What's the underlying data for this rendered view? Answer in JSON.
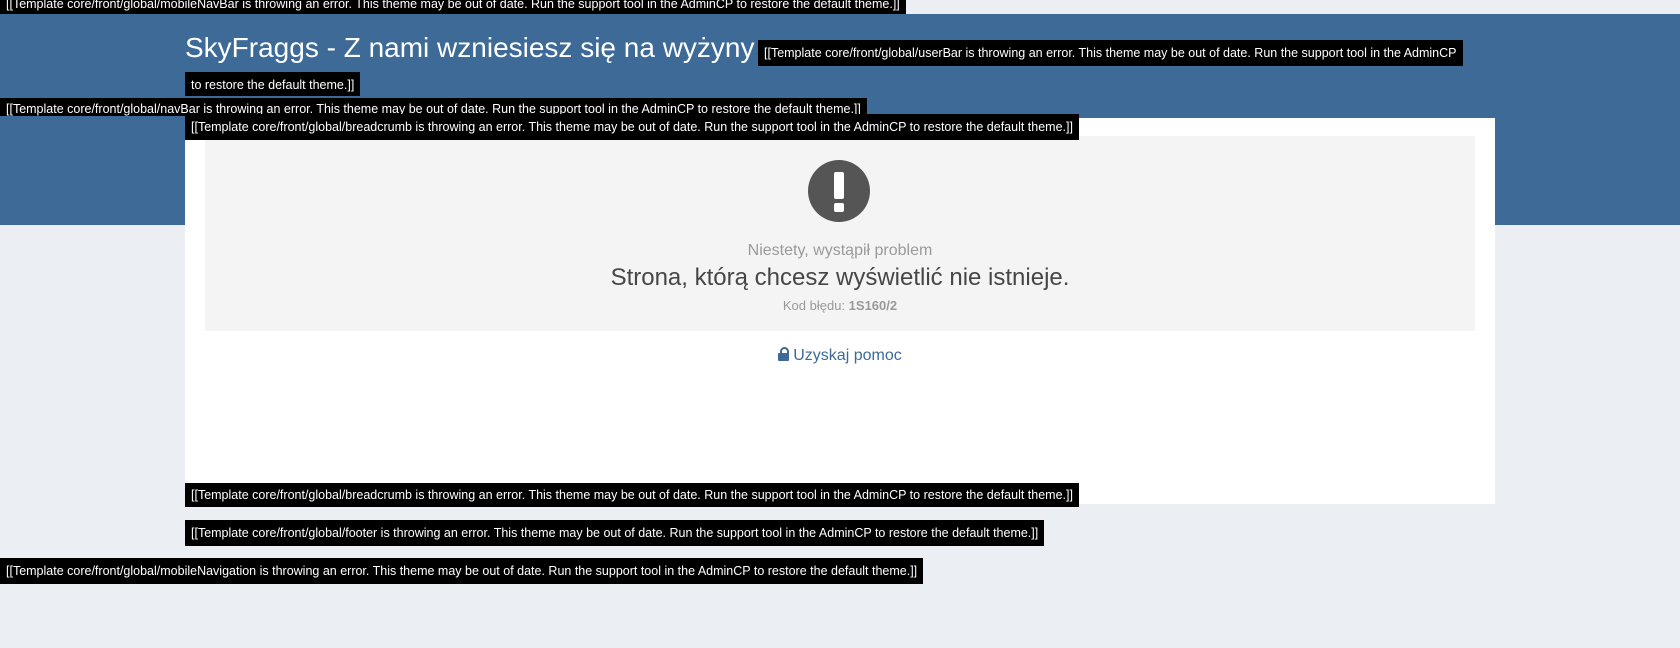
{
  "errors": {
    "mobile_nav_bar": "[[Template core/front/global/mobileNavBar is throwing an error. This theme may be out of date. Run the support tool in the AdminCP to restore the default theme.]]",
    "user_bar_line1": "[[Template core/front/global/userBar is throwing an error. This theme may be out of date. Run the support tool in the AdminCP",
    "user_bar_line2": "to restore the default theme.]]",
    "nav_bar": "[[Template core/front/global/navBar is throwing an error. This theme may be out of date. Run the support tool in the AdminCP to restore the default theme.]]",
    "breadcrumb_top": "[[Template core/front/global/breadcrumb is throwing an error. This theme may be out of date. Run the support tool in the AdminCP to restore the default theme.]]",
    "breadcrumb_bottom": "[[Template core/front/global/breadcrumb is throwing an error. This theme may be out of date. Run the support tool in the AdminCP to restore the default theme.]]",
    "footer": "[[Template core/front/global/footer is throwing an error. This theme may be out of date. Run the support tool in the AdminCP to restore the default theme.]]",
    "mobile_navigation": "[[Template core/front/global/mobileNavigation is throwing an error. This theme may be out of date. Run the support tool in the AdminCP to restore the default theme.]]"
  },
  "header": {
    "site_title": "SkyFraggs - Z nami wzniesiesz się na wyżyny"
  },
  "error_page": {
    "icon": "exclamation-circle-icon",
    "subtitle": "Niestety, wystąpił problem",
    "message": "Strona, którą chcesz wyświetlić nie istnieje.",
    "code_label": "Kod błędu:",
    "code_value": "1S160/2",
    "help_icon": "lock-icon",
    "help_label": "Uzyskaj pomoc"
  },
  "colors": {
    "header_band": "#3d6a96",
    "page_background": "#ebeef2",
    "link": "#3d6a96"
  }
}
